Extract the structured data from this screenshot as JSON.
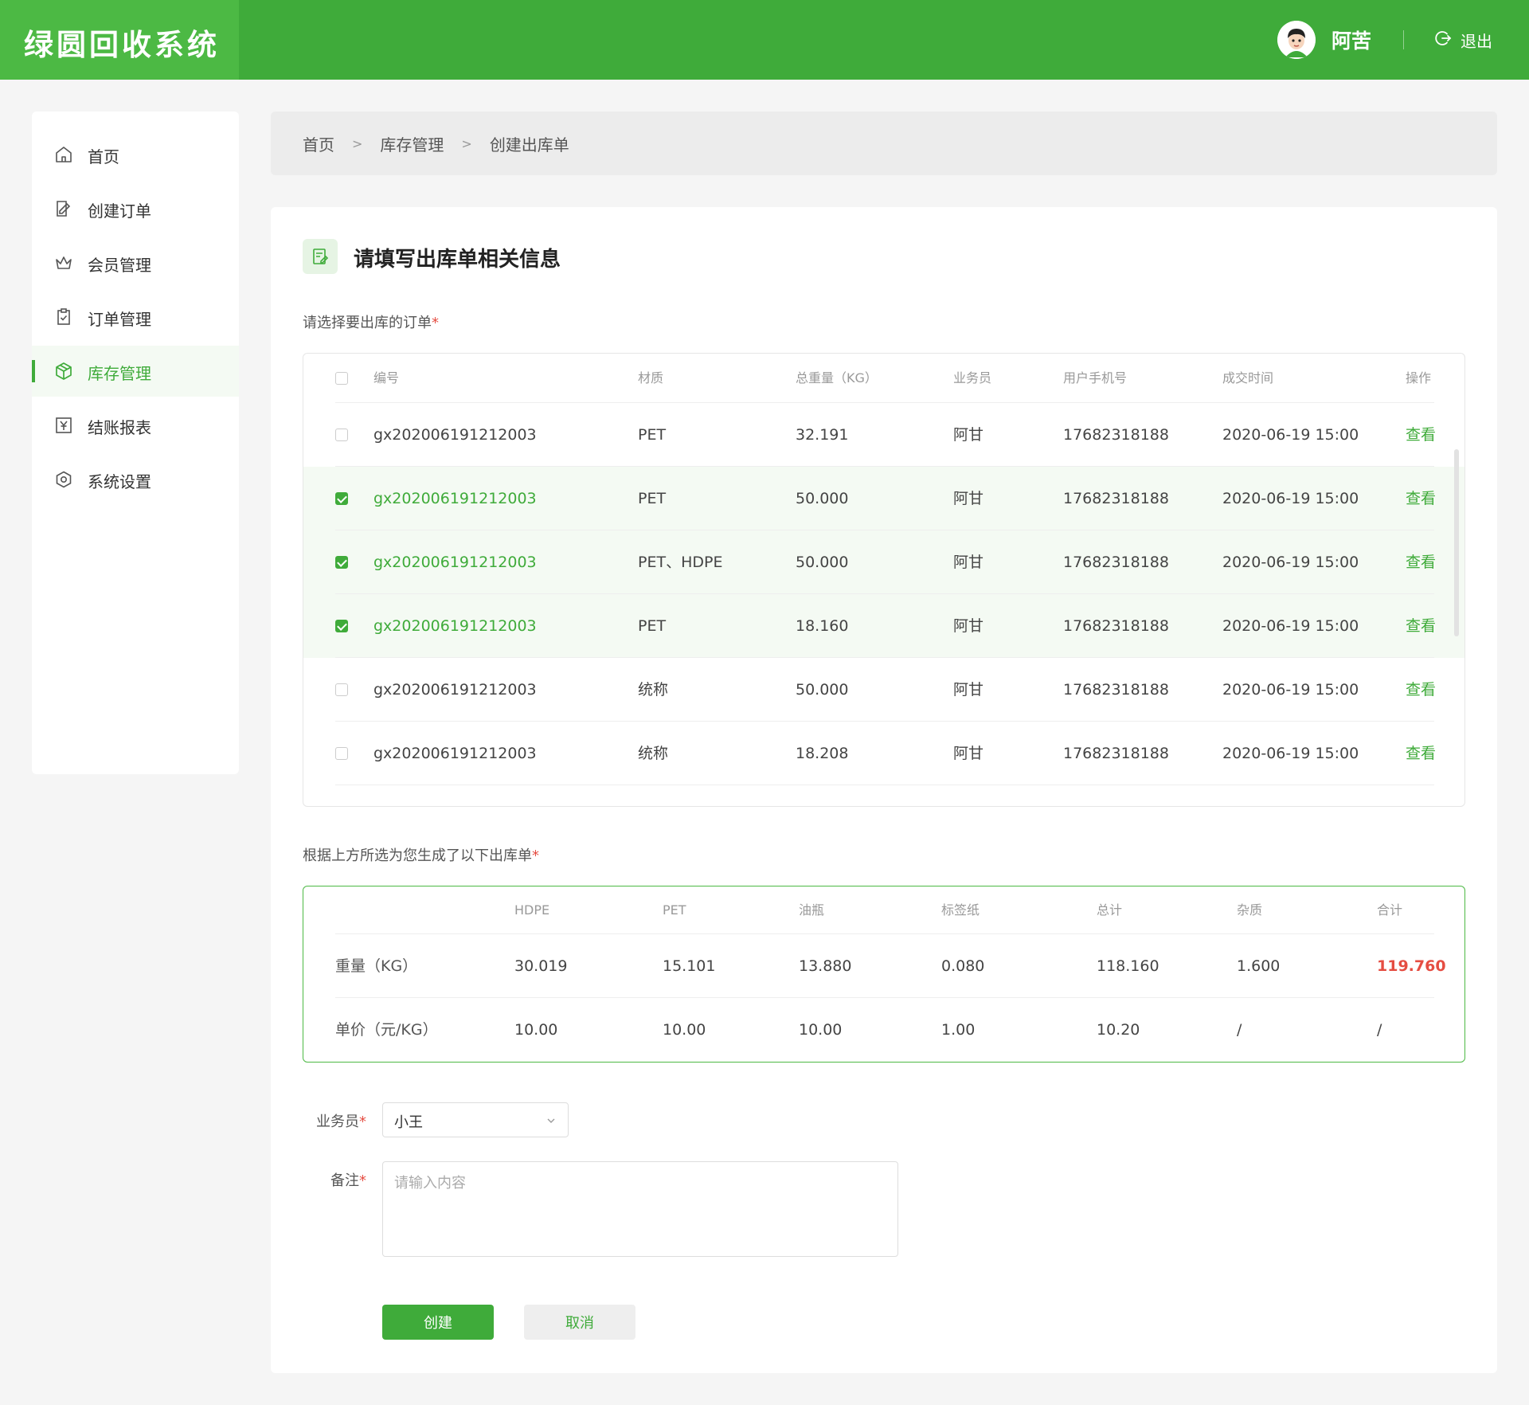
{
  "app": {
    "title": "绿圆回收系统"
  },
  "user": {
    "name": "阿苦",
    "logout_label": "退出"
  },
  "sidebar": {
    "items": [
      {
        "label": "首页",
        "icon": "home-icon"
      },
      {
        "label": "创建订单",
        "icon": "edit-icon"
      },
      {
        "label": "会员管理",
        "icon": "crown-icon"
      },
      {
        "label": "订单管理",
        "icon": "clipboard-check-icon"
      },
      {
        "label": "库存管理",
        "icon": "cube-icon",
        "active": true
      },
      {
        "label": "结账报表",
        "icon": "yen-report-icon"
      },
      {
        "label": "系统设置",
        "icon": "gear-icon"
      }
    ]
  },
  "breadcrumb": [
    "首页",
    "库存管理",
    "创建出库单"
  ],
  "panel": {
    "title": "请填写出库单相关信息"
  },
  "orders": {
    "label": "请选择要出库的订单",
    "required_mark": "*",
    "headers": [
      "编号",
      "材质",
      "总重量（KG）",
      "业务员",
      "用户手机号",
      "成交时间",
      "操作"
    ],
    "rows": [
      {
        "checked": false,
        "code": "gx202006191212003",
        "material": "PET",
        "weight": "32.191",
        "staff": "阿甘",
        "phone": "17682318188",
        "time": "2020-06-19  15:00",
        "action": "查看"
      },
      {
        "checked": true,
        "code": "gx202006191212003",
        "material": "PET",
        "weight": "50.000",
        "staff": "阿甘",
        "phone": "17682318188",
        "time": "2020-06-19  15:00",
        "action": "查看"
      },
      {
        "checked": true,
        "code": "gx202006191212003",
        "material": "PET、HDPE",
        "weight": "50.000",
        "staff": "阿甘",
        "phone": "17682318188",
        "time": "2020-06-19  15:00",
        "action": "查看"
      },
      {
        "checked": true,
        "code": "gx202006191212003",
        "material": "PET",
        "weight": "18.160",
        "staff": "阿甘",
        "phone": "17682318188",
        "time": "2020-06-19  15:00",
        "action": "查看"
      },
      {
        "checked": false,
        "code": "gx202006191212003",
        "material": "统称",
        "weight": "50.000",
        "staff": "阿甘",
        "phone": "17682318188",
        "time": "2020-06-19  15:00",
        "action": "查看"
      },
      {
        "checked": false,
        "code": "gx202006191212003",
        "material": "统称",
        "weight": "18.208",
        "staff": "阿甘",
        "phone": "17682318188",
        "time": "2020-06-19  15:00",
        "action": "查看"
      }
    ]
  },
  "summary": {
    "label": "根据上方所选为您生成了以下出库单",
    "required_mark": "*",
    "headers": [
      "HDPE",
      "PET",
      "油瓶",
      "标签纸",
      "总计",
      "杂质",
      "合计"
    ],
    "rows": [
      {
        "label": "重量（KG）",
        "values": [
          "30.019",
          "15.101",
          "13.880",
          "0.080",
          "118.160",
          "1.600",
          "119.760"
        ]
      },
      {
        "label": "单价（元/KG）",
        "values": [
          "10.00",
          "10.00",
          "10.00",
          "1.00",
          "10.20",
          "/",
          "/"
        ]
      }
    ]
  },
  "form": {
    "staff_label": "业务员",
    "staff_value": "小王",
    "remark_label": "备注",
    "remark_placeholder": "请输入内容",
    "required_mark": "*",
    "create_label": "创建",
    "cancel_label": "取消"
  },
  "colors": {
    "primary": "#3fab3a",
    "accent_red": "#e54d42"
  }
}
